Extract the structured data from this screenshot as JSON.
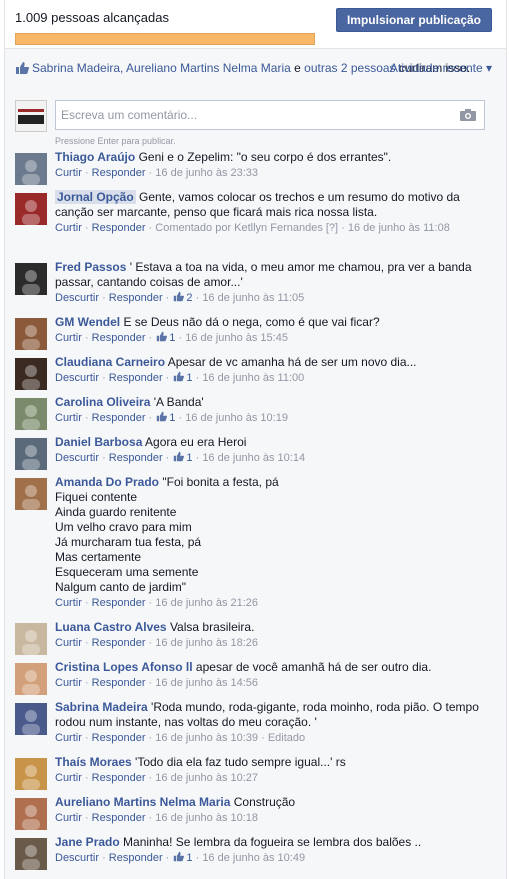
{
  "reach": {
    "text": "1.009 pessoas alcançadas",
    "boost_label": "Impulsionar publicação"
  },
  "likes": {
    "people": "Sabrina Madeira, Aureliano Martins Nelma Maria",
    "and": "e",
    "others": "outras 2 pessoas",
    "tail": "curtiram isso.",
    "activity_label": "Atividade recente ▾"
  },
  "composer": {
    "placeholder": "Escreva um comentário...",
    "hint": "Pressione Enter para publicar."
  },
  "comments": [
    {
      "name": "Thiago Araújo",
      "text": "Geni e o Zepelim: \"o seu corpo é dos errantes\".",
      "actions": [
        "Curtir",
        "Responder"
      ],
      "likes": "",
      "time": "16 de junho às 23:33",
      "extra": "",
      "color": "#6b7a8c"
    },
    {
      "name": "Jornal Opção",
      "text": "Gente, vamos colocar os trechos e um resumo do motivo da canção ser marcante, penso que ficará mais rica nossa lista.",
      "actions": [
        "Curtir",
        "Responder"
      ],
      "likes": "",
      "time": "16 de junho às 11:08",
      "extra": "Comentado por Ketllyn Fernandes [?]",
      "color": "#9a2a2a"
    },
    {
      "name": "Fred Passos",
      "text": "' Estava a toa na vida, o meu amor me chamou, pra ver a banda passar, cantando coisas de amor...'",
      "actions": [
        "Descurtir",
        "Responder"
      ],
      "likes": "2",
      "time": "16 de junho às 11:05",
      "extra": "",
      "color": "#2b2b2b"
    },
    {
      "name": "GM Wendel",
      "text": "E se Deus não dá o nega, como é que vai ficar?",
      "actions": [
        "Curtir",
        "Responder"
      ],
      "likes": "1",
      "time": "16 de junho às 15:45",
      "extra": "",
      "color": "#8a5a3a"
    },
    {
      "name": "Claudiana Carneiro",
      "text": "Apesar de vc amanha há de ser um novo dia...",
      "actions": [
        "Descurtir",
        "Responder"
      ],
      "likes": "1",
      "time": "16 de junho às 11:00",
      "extra": "",
      "color": "#3a2a22"
    },
    {
      "name": "Carolina Oliveira",
      "text": "'A Banda'",
      "actions": [
        "Curtir",
        "Responder"
      ],
      "likes": "1",
      "time": "16 de junho às 10:19",
      "extra": "",
      "color": "#7a8a6a"
    },
    {
      "name": "Daniel Barbosa",
      "text": "Agora eu era Heroi",
      "actions": [
        "Descurtir",
        "Responder"
      ],
      "likes": "1",
      "time": "16 de junho às 10:14",
      "extra": "",
      "color": "#5a6a7a"
    },
    {
      "name": "Amanda Do Prado",
      "text": "\"Foi bonita a festa, pá\nFiquei contente\nAinda guardo renitente\nUm velho cravo para mim\nJá murcharam tua festa, pá\nMas certamente\nEsqueceram uma semente\nNalgum canto de jardim\"",
      "actions": [
        "Curtir",
        "Responder"
      ],
      "likes": "",
      "time": "16 de junho às 21:26",
      "extra": "",
      "color": "#a0704a"
    },
    {
      "name": "Luana Castro Alves",
      "text": "Valsa brasileira.",
      "actions": [
        "Curtir",
        "Responder"
      ],
      "likes": "",
      "time": "16 de junho às 18:26",
      "extra": "",
      "color": "#c9b8a0"
    },
    {
      "name": "Cristina Lopes Afonso ll",
      "text": "apesar de você amanhã há de ser outro dia.",
      "actions": [
        "Curtir",
        "Responder"
      ],
      "likes": "",
      "time": "16 de junho às 14:56",
      "extra": "",
      "color": "#d2a07a"
    },
    {
      "name": "Sabrina Madeira",
      "text": "'Roda mundo, roda-gigante, roda moinho, roda pião. O tempo rodou num instante, nas voltas do meu coração. '",
      "actions": [
        "Curtir",
        "Responder"
      ],
      "likes": "",
      "time": "16 de junho às 10:39",
      "extra": "Editado",
      "color": "#4a5a8a"
    },
    {
      "name": "Thaís Moraes",
      "text": "'Todo dia ela faz tudo sempre igual...' rs",
      "actions": [
        "Curtir",
        "Responder"
      ],
      "likes": "",
      "time": "16 de junho às 10:27",
      "extra": "",
      "color": "#c8944a"
    },
    {
      "name": "Aureliano Martins Nelma Maria",
      "text": "Construção",
      "actions": [
        "Curtir",
        "Responder"
      ],
      "likes": "",
      "time": "16 de junho às 10:18",
      "extra": "",
      "color": "#b07050"
    },
    {
      "name": "Jane Prado",
      "text": "Maninha! Se lembra da fogueira se lembra dos balões ..",
      "actions": [
        "Descurtir",
        "Responder"
      ],
      "likes": "1",
      "time": "16 de junho às 10:49",
      "extra": "",
      "color": "#6a5a4a"
    }
  ]
}
